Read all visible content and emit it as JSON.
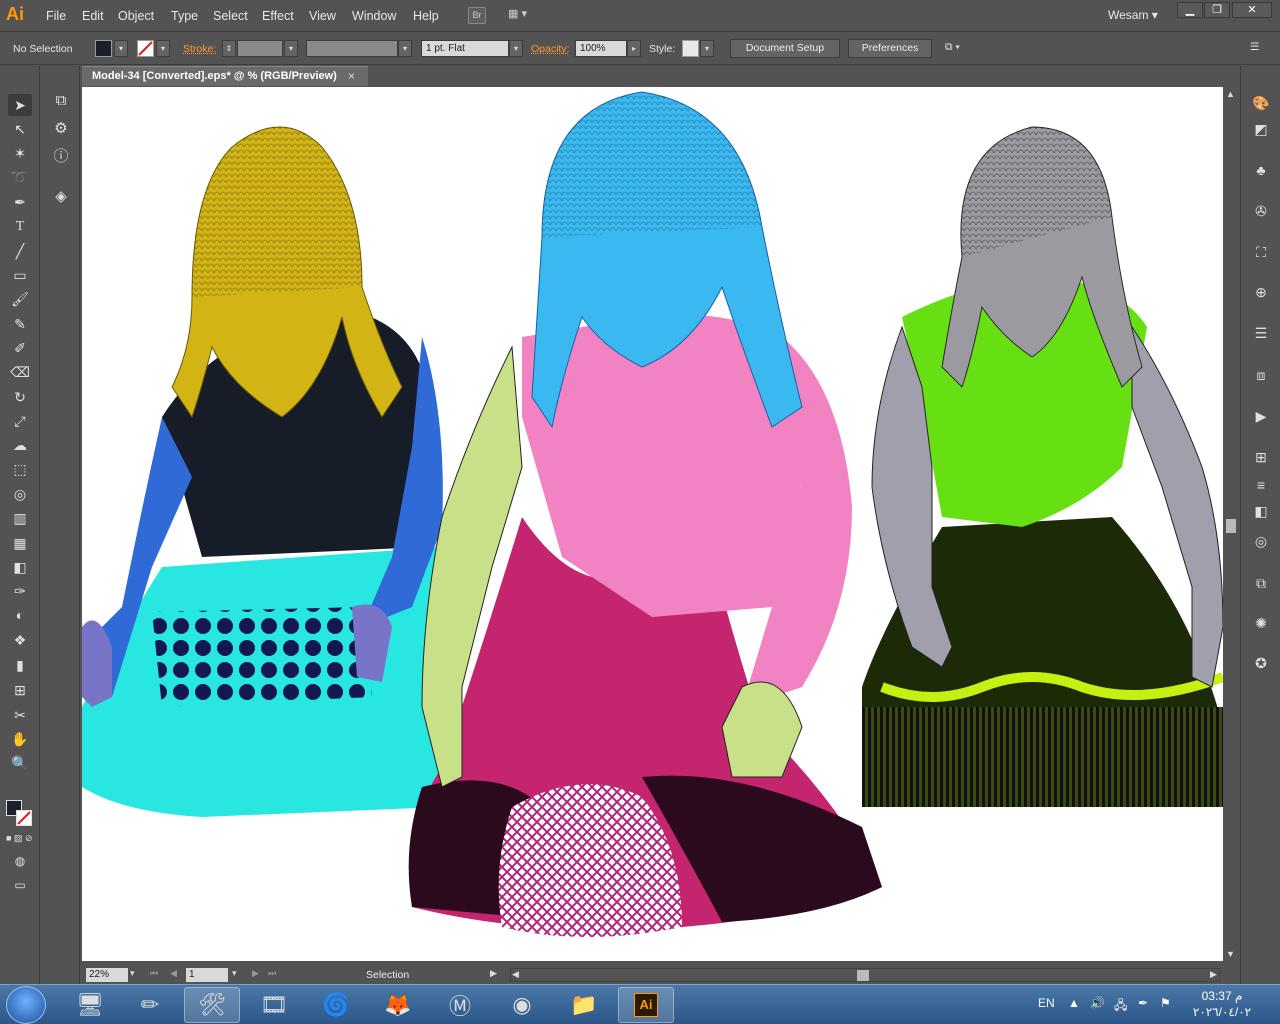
{
  "app": {
    "logo": "Ai",
    "user": "Wesam",
    "bridge_label": "Br"
  },
  "menu": [
    "File",
    "Edit",
    "Object",
    "Type",
    "Select",
    "Effect",
    "View",
    "Window",
    "Help"
  ],
  "control": {
    "selection": "No Selection",
    "stroke_label": "Stroke:",
    "stroke_profile": "1 pt. Flat",
    "opacity_label": "Opacity:",
    "opacity_value": "100%",
    "style_label": "Style:",
    "document_setup": "Document Setup",
    "preferences": "Preferences"
  },
  "document": {
    "tab_title": "Model-34 [Converted].eps* @ % (RGB/Preview)",
    "close": "×"
  },
  "status": {
    "zoom": "22%",
    "page": "1",
    "mode": "Selection"
  },
  "taskbar": {
    "language": "EN",
    "time": "03:37 م",
    "date": "٢٠٢٦/٠٤/٠٢"
  },
  "icons": {
    "tools": [
      "selection-tool-icon",
      "direct-selection-tool-icon",
      "magic-wand-tool-icon",
      "lasso-tool-icon",
      "pen-tool-icon",
      "type-tool-icon",
      "line-segment-tool-icon",
      "rectangle-tool-icon",
      "paintbrush-tool-icon",
      "pencil-tool-icon",
      "blob-brush-tool-icon",
      "eraser-tool-icon",
      "rotate-tool-icon",
      "scale-tool-icon",
      "warp-tool-icon",
      "free-transform-tool-icon",
      "shape-builder-tool-icon",
      "perspective-grid-tool-icon",
      "mesh-tool-icon",
      "gradient-tool-icon",
      "eyedropper-tool-icon",
      "blend-tool-icon",
      "symbol-sprayer-tool-icon",
      "column-graph-tool-icon",
      "artboard-tool-icon",
      "slice-tool-icon",
      "hand-tool-icon",
      "zoom-tool-icon"
    ],
    "colors": {
      "fill": "#1b1f2a",
      "stroke": "none"
    }
  }
}
